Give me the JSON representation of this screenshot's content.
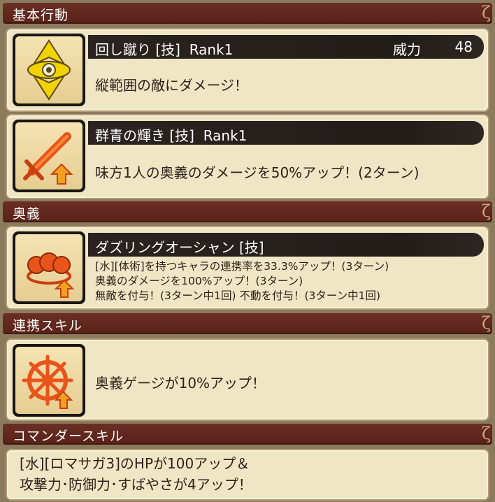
{
  "sections": {
    "basic": "基本行動",
    "ougi": "奥義",
    "renkei": "連携スキル",
    "commander": "コマンダースキル"
  },
  "skills": [
    {
      "name": "回し蹴り [技]",
      "rank": "Rank1",
      "power_label": "威力",
      "power_value": "48",
      "desc": "縦範囲の敵にダメージ！",
      "icon": "eye-diamond-icon"
    },
    {
      "name": "群青の輝き [技]",
      "rank": "Rank1",
      "desc": "味方1人の奥義のダメージを50%アップ！(2ターン)",
      "icon": "sword-up-icon"
    }
  ],
  "ougi": {
    "name": "ダズリングオーシャン [技]",
    "lines": [
      "[水][体術]を持つキャラの連携率を33.3%アップ！(3ターン)",
      "奥義のダメージを100%アップ！(3ターン)",
      "無敵を付与！(3ターン中1回) 不動を付与！(3ターン中1回)"
    ],
    "icon": "fists-up-icon"
  },
  "renkei": {
    "desc": "奥義ゲージが10%アップ！",
    "icon": "wheel-up-icon"
  },
  "commander": {
    "lines": [
      "[水][ロマサガ3]のHPが100アップ＆",
      "攻撃力･防御力･すばやさが4アップ！"
    ]
  },
  "colors": {
    "header": "#5a2219",
    "panel": "#efe6c6",
    "icon_accent": "#e8541a",
    "icon_yellow": "#f2d200"
  }
}
